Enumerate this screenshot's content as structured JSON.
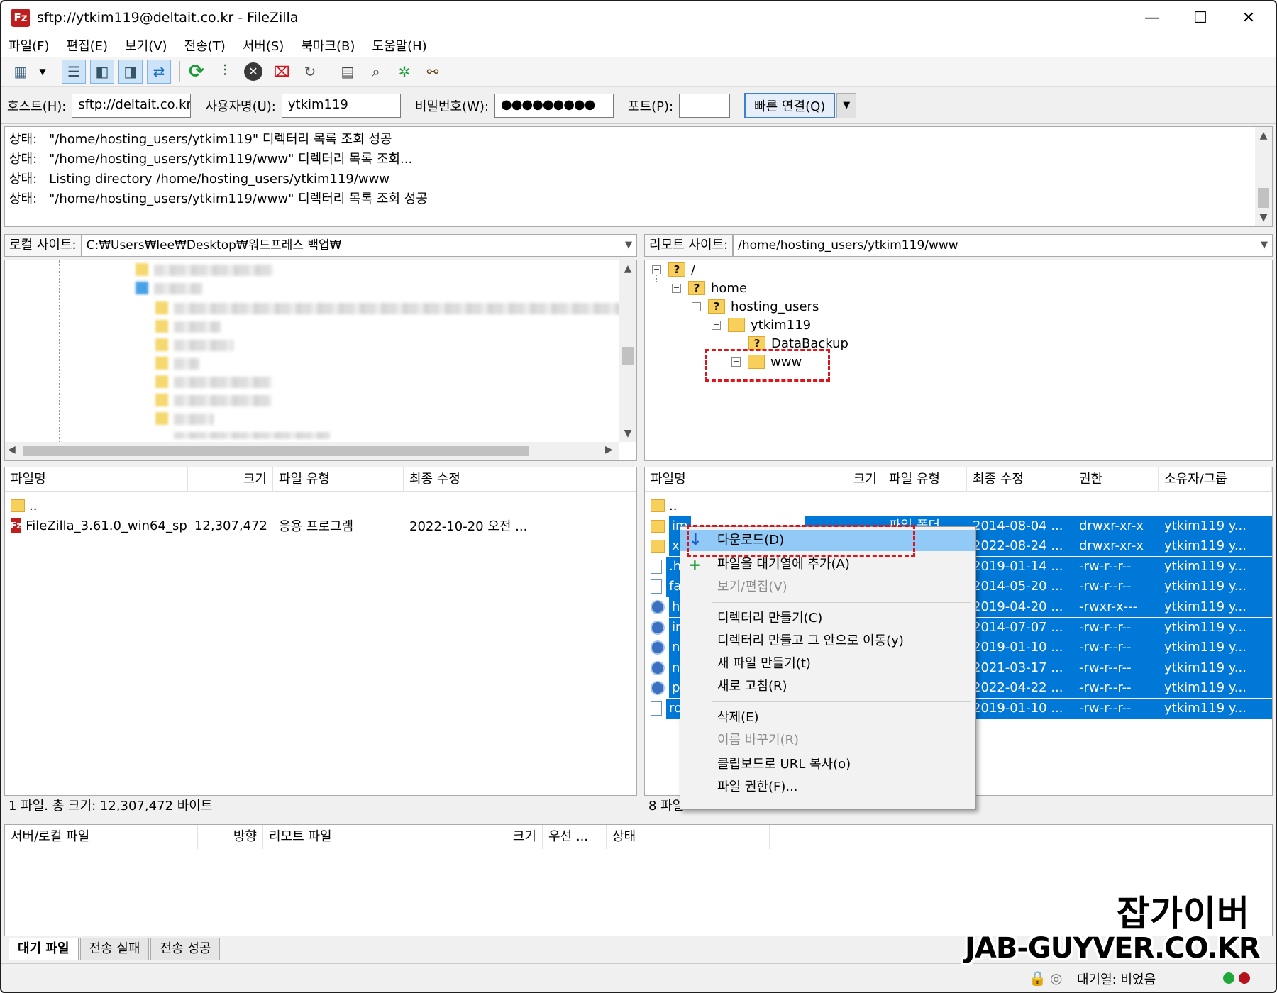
{
  "window": {
    "title": "sftp://ytkim119@deltait.co.kr - FileZilla",
    "app_icon": "Fz",
    "minimize": "—",
    "maximize": "☐",
    "close": "✕"
  },
  "menu": [
    "파일(F)",
    "편집(E)",
    "보기(V)",
    "전송(T)",
    "서버(S)",
    "북마크(B)",
    "도움말(H)"
  ],
  "quickconnect": {
    "host_label": "호스트(H):",
    "host_value": "sftp://deltait.co.kr",
    "user_label": "사용자명(U):",
    "user_value": "ytkim119",
    "pass_label": "비밀번호(W):",
    "pass_value": "●●●●●●●●●",
    "port_label": "포트(P):",
    "port_value": "",
    "connect_button": "빠른 연결(Q)"
  },
  "log": [
    {
      "label": "상태:",
      "text": "\"/home/hosting_users/ytkim119\" 디렉터리 목록 조회 성공"
    },
    {
      "label": "상태:",
      "text": "\"/home/hosting_users/ytkim119/www\" 디렉터리 목록 조회..."
    },
    {
      "label": "상태:",
      "text": "Listing directory /home/hosting_users/ytkim119/www"
    },
    {
      "label": "상태:",
      "text": "\"/home/hosting_users/ytkim119/www\" 디렉터리 목록 조회 성공"
    }
  ],
  "local": {
    "site_label": "로컬 사이트:",
    "path": "C:₩Users₩lee₩Desktop₩워드프레스 백업₩",
    "columns": [
      "파일명",
      "크기",
      "파일 유형",
      "최종 수정"
    ],
    "files": [
      {
        "name": "..",
        "size": "",
        "type": "",
        "modified": ""
      },
      {
        "name": "FileZilla_3.61.0_win64_sp...",
        "size": "12,307,472",
        "type": "응용 프로그램",
        "modified": "2022-10-20 오전 ..."
      }
    ],
    "status": "1 파일. 총 크기: 12,307,472 바이트"
  },
  "remote": {
    "site_label": "리모트 사이트:",
    "path": "/home/hosting_users/ytkim119/www",
    "tree": [
      {
        "label": "/",
        "unknown": true
      },
      {
        "label": "home",
        "unknown": true
      },
      {
        "label": "hosting_users",
        "unknown": true
      },
      {
        "label": "ytkim119",
        "unknown": false
      },
      {
        "label": "DataBackup",
        "unknown": true
      },
      {
        "label": "www",
        "unknown": false
      }
    ],
    "columns": [
      "파일명",
      "크기",
      "파일 유형",
      "최종 수정",
      "권한",
      "소유자/그룹"
    ],
    "files": [
      {
        "name": "..",
        "type_text": "",
        "modified": "",
        "perm": "",
        "owner": ""
      },
      {
        "name": "im",
        "type_text": "파일 폴더",
        "modified": "2014-08-04 ...",
        "perm": "drwxr-xr-x",
        "owner": "ytkim119 y..."
      },
      {
        "name": "xe",
        "type_text": "",
        "modified": "2022-08-24 ...",
        "perm": "drwxr-xr-x",
        "owner": "ytkim119 y..."
      },
      {
        "name": ".h",
        "type_text": "",
        "modified": "2019-01-14 ...",
        "perm": "-rw-r--r--",
        "owner": "ytkim119 y..."
      },
      {
        "name": "fa",
        "type_text": "",
        "modified": "2014-05-20 ...",
        "perm": "-rw-r--r--",
        "owner": "ytkim119 y..."
      },
      {
        "name": "ho",
        "type_text": "",
        "modified": "2019-04-20 ...",
        "perm": "-rwxr-x---",
        "owner": "ytkim119 y..."
      },
      {
        "name": "in",
        "type_text": "",
        "modified": "2014-07-07 ...",
        "perm": "-rw-r--r--",
        "owner": "ytkim119 y..."
      },
      {
        "name": "na",
        "type_text": "",
        "modified": "2019-01-10 ...",
        "perm": "-rw-r--r--",
        "owner": "ytkim119 y..."
      },
      {
        "name": "na",
        "type_text": "",
        "modified": "2021-03-17 ...",
        "perm": "-rw-r--r--",
        "owner": "ytkim119 y..."
      },
      {
        "name": "pi",
        "type_text": "",
        "modified": "2022-04-22 ...",
        "perm": "-rw-r--r--",
        "owner": "ytkim119 y..."
      },
      {
        "name": "ro",
        "type_text": "",
        "modified": "2019-01-10 ...",
        "perm": "-rw-r--r--",
        "owner": "ytkim119 y..."
      }
    ],
    "status": "8 파일"
  },
  "context_menu": [
    {
      "label": "다운로드(D)",
      "state": "highlighted"
    },
    {
      "label": "파일을 대기열에 추가(A)",
      "state": "normal"
    },
    {
      "label": "보기/편집(V)",
      "state": "disabled"
    },
    {
      "label": "디렉터리 만들기(C)",
      "state": "normal"
    },
    {
      "label": "디렉터리 만들고 그 안으로 이동(y)",
      "state": "normal"
    },
    {
      "label": "새 파일 만들기(t)",
      "state": "normal"
    },
    {
      "label": "새로 고침(R)",
      "state": "normal"
    },
    {
      "label": "삭제(E)",
      "state": "normal"
    },
    {
      "label": "이름 바꾸기(R)",
      "state": "disabled"
    },
    {
      "label": "클립보드로 URL 복사(o)",
      "state": "normal"
    },
    {
      "label": "파일 권한(F)...",
      "state": "normal"
    }
  ],
  "queue": {
    "columns": [
      "서버/로컬 파일",
      "방향",
      "리모트 파일",
      "크기",
      "우선 ...",
      "상태"
    ],
    "tabs": [
      "대기 파일",
      "전송 실패",
      "전송 성공"
    ],
    "status": "대기열: 비었음"
  },
  "watermark": {
    "line1": "잡가이버",
    "line2": "JAB-GUYVER.CO.KR"
  },
  "colors": {
    "selection": "#0078d7",
    "menu_highlight": "#91c9f7",
    "annotation": "#e0121a",
    "folder": "#f7cf5a"
  }
}
